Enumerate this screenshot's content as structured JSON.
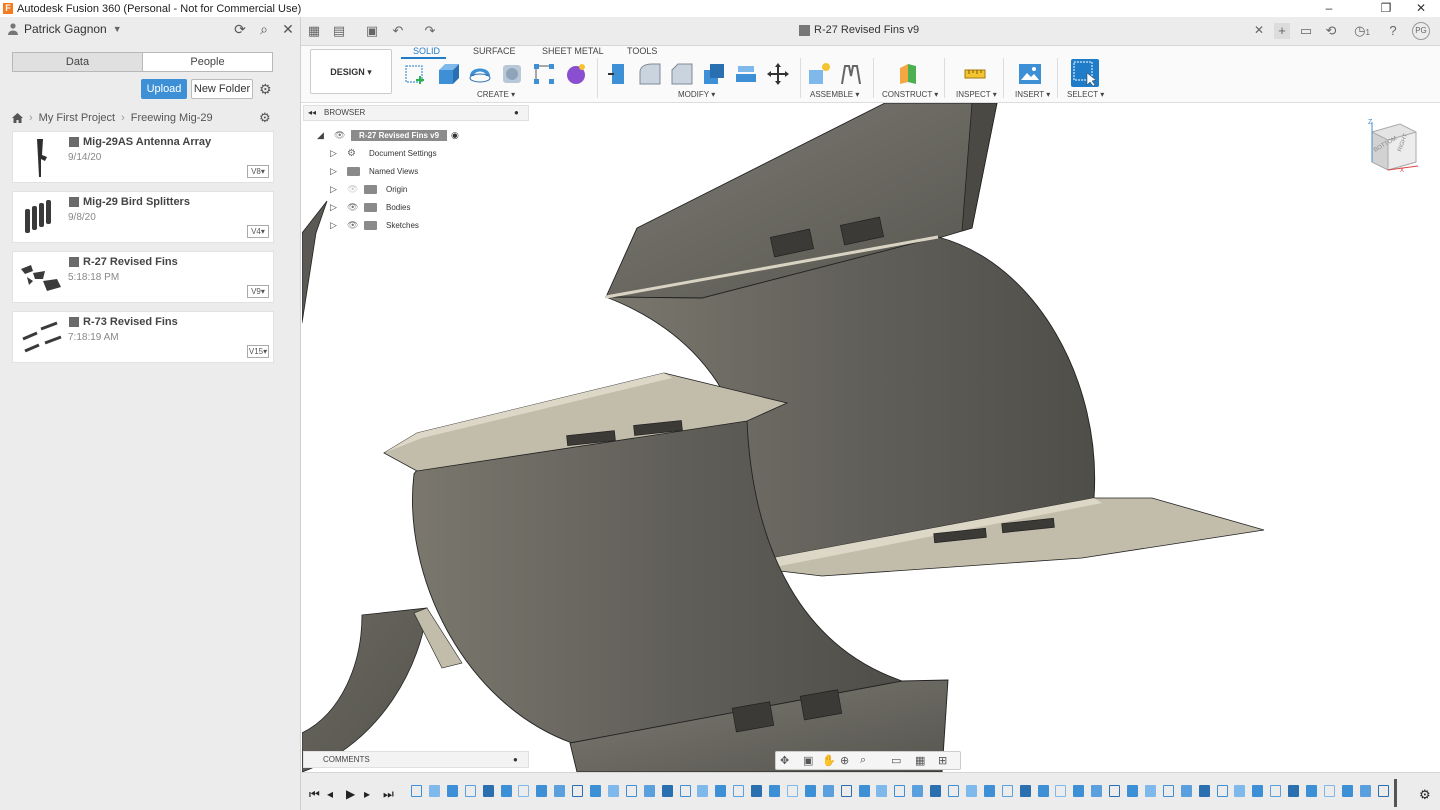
{
  "window": {
    "title": "Autodesk Fusion 360 (Personal - Not for Commercial Use)",
    "min": "–",
    "restore": "❐",
    "close": "✕"
  },
  "data_panel": {
    "user": "Patrick Gagnon",
    "tabs": [
      "Data",
      "People"
    ],
    "upload": "Upload",
    "new_folder": "New Folder",
    "breadcrumb": [
      "My First Project",
      "Freewing Mig-29"
    ],
    "files": [
      {
        "name": "Mig-29AS Antenna Array",
        "date": "9/14/20",
        "version": "V8▾"
      },
      {
        "name": "Mig-29 Bird Splitters",
        "date": "9/8/20",
        "version": "V4▾"
      },
      {
        "name": "R-27 Revised Fins",
        "date": "5:18:18 PM",
        "version": "V9▾"
      },
      {
        "name": "R-73 Revised Fins",
        "date": "7:18:19 AM",
        "version": "V15▾"
      }
    ]
  },
  "tabbar": {
    "doc_title": "R-27 Revised Fins v9",
    "close": "✕",
    "notify_count": "1",
    "avatar": "PG"
  },
  "toolbar": {
    "design": "DESIGN ▾",
    "workspace_tabs": [
      "SOLID",
      "SURFACE",
      "SHEET METAL",
      "TOOLS"
    ],
    "groups": [
      "CREATE ▾",
      "MODIFY ▾",
      "ASSEMBLE ▾",
      "CONSTRUCT ▾",
      "INSPECT ▾",
      "INSERT ▾",
      "SELECT ▾"
    ]
  },
  "browser": {
    "title": "BROWSER",
    "root": "R-27 Revised Fins v9",
    "items": [
      "Document Settings",
      "Named Views",
      "Origin",
      "Bodies",
      "Sketches"
    ]
  },
  "viewcube": {
    "faces": [
      "RIGHT",
      "BOTTOM"
    ],
    "axis_z": "Z",
    "axis_x": "X"
  },
  "comments": {
    "title": "COMMENTS"
  },
  "colors": {
    "accent": "#1f7cc9",
    "upload": "#3d8fd6",
    "panel_bg": "#ececec",
    "model_dark": "#5e5d57",
    "model_light": "#c2bcaa"
  }
}
